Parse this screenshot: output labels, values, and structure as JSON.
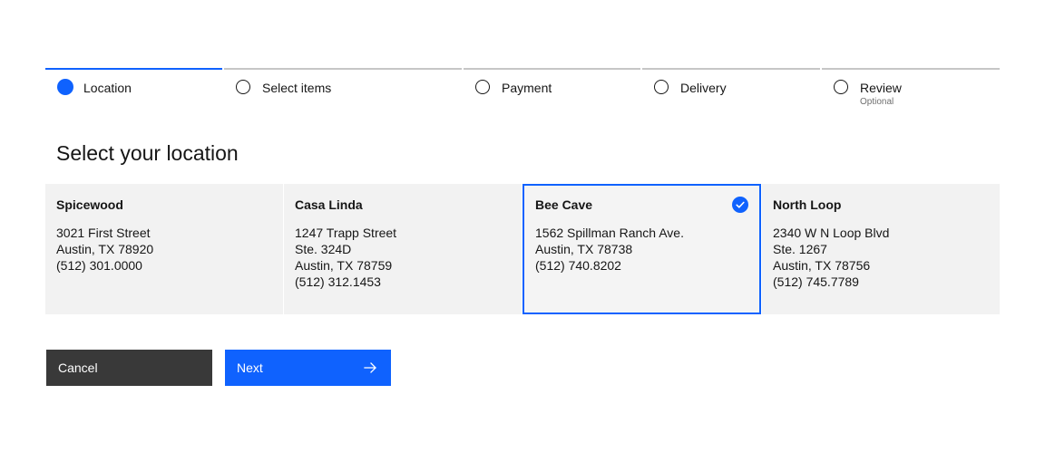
{
  "progress": {
    "steps": [
      {
        "label": "Location",
        "state": "current"
      },
      {
        "label": "Select items",
        "state": "incomplete"
      },
      {
        "label": "Payment",
        "state": "incomplete"
      },
      {
        "label": "Delivery",
        "state": "incomplete"
      },
      {
        "label": "Review",
        "state": "incomplete",
        "secondary": "Optional"
      }
    ]
  },
  "heading": "Select your location",
  "locations": [
    {
      "name": "Spicewood",
      "lines": [
        "3021 First Street",
        "Austin, TX 78920",
        "(512) 301.0000"
      ],
      "selected": false
    },
    {
      "name": "Casa Linda",
      "lines": [
        "1247 Trapp Street",
        "Ste. 324D",
        "Austin, TX 78759",
        "(512) 312.1453"
      ],
      "selected": false
    },
    {
      "name": "Bee Cave",
      "lines": [
        "1562 Spillman Ranch Ave.",
        "Austin, TX 78738",
        "(512) 740.8202"
      ],
      "selected": true
    },
    {
      "name": "North Loop",
      "lines": [
        "2340 W N Loop Blvd",
        "Ste. 1267",
        "Austin, TX 78756",
        "(512) 745.7789"
      ],
      "selected": false
    }
  ],
  "buttons": {
    "cancel_label": "Cancel",
    "next_label": "Next"
  },
  "icons": {
    "selected": "checkmark-filled-icon",
    "next": "arrow-right-icon"
  },
  "colors": {
    "primary": "#0f62fe",
    "secondary_button": "#393939",
    "tile_background": "#f2f2f2",
    "text": "#161616"
  }
}
